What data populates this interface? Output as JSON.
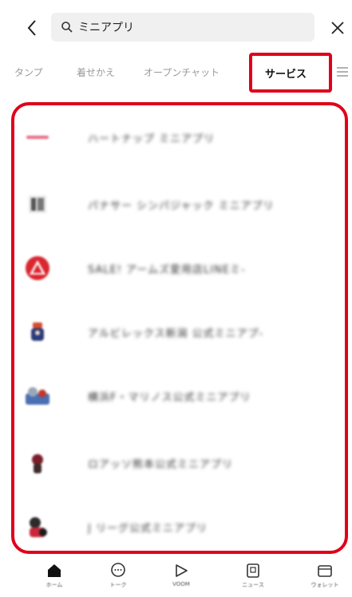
{
  "header": {
    "search_value": "ミニアプリ",
    "search_placeholder": "検索"
  },
  "tabs": [
    {
      "label": "タンプ"
    },
    {
      "label": "着せかえ"
    },
    {
      "label": "オープンチャット"
    },
    {
      "label": "サービス",
      "active": true
    }
  ],
  "results": [
    {
      "label": "ハートナップ ミニアプリ",
      "icon": "pink-logo-icon"
    },
    {
      "label": "パナサー シンパジャック ミニアプリ",
      "icon": "building-logo-icon"
    },
    {
      "label": "SALE! アームズ愛用店LINEミ-",
      "icon": "red-triangle-logo-icon"
    },
    {
      "label": "アルビレックス新潟 公式ミニアプ-",
      "icon": "mascot-icon"
    },
    {
      "label": "横浜F・マリノス公式ミニアプリ",
      "icon": "team-logo-icon"
    },
    {
      "label": "ロアッソ熊本公式ミニアプリ",
      "icon": "mascot-icon"
    },
    {
      "label": "J リーグ公式ミニアプリ",
      "icon": "mascot-icon"
    }
  ],
  "bottom_nav": [
    {
      "label": "ホーム",
      "icon": "home-icon"
    },
    {
      "label": "トーク",
      "icon": "chat-icon"
    },
    {
      "label": "VOOM",
      "icon": "voom-icon"
    },
    {
      "label": "ニュース",
      "icon": "news-icon"
    },
    {
      "label": "ウォレット",
      "icon": "wallet-icon"
    }
  ],
  "colors": {
    "highlight": "#e0001b",
    "search_bg": "#f0f0f0"
  }
}
